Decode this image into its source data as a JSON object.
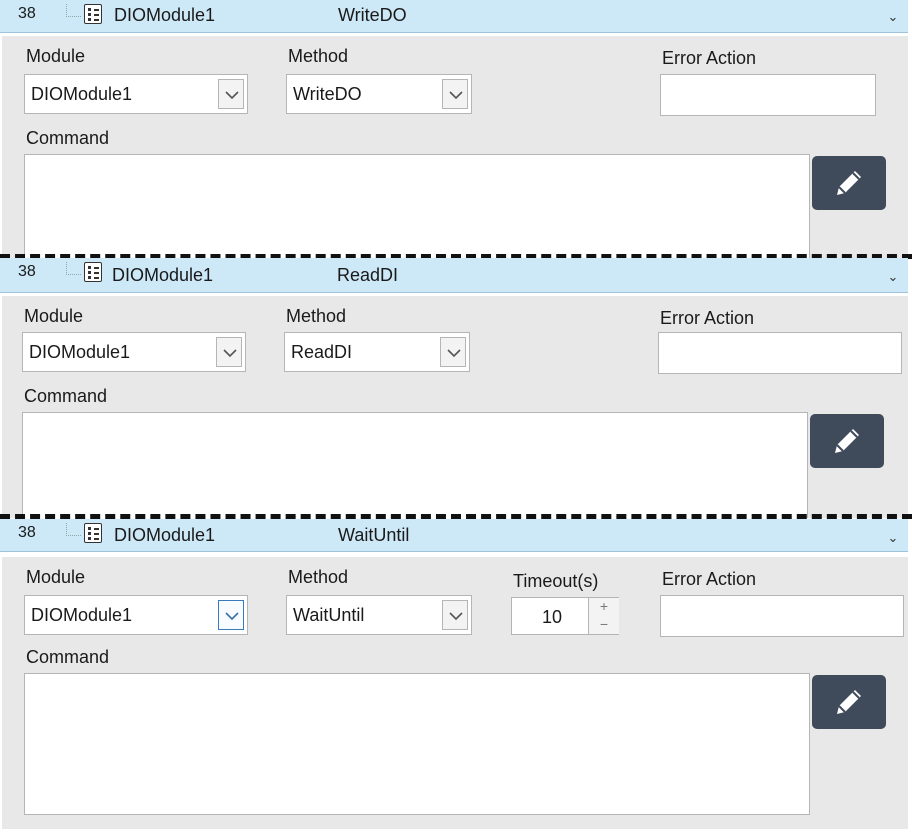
{
  "sections": [
    {
      "step_number": "38",
      "module_name": "DIOModule1",
      "method_name": "WriteDO",
      "labels": {
        "module": "Module",
        "method": "Method",
        "error_action": "Error Action",
        "command": "Command"
      },
      "module_value": "DIOModule1",
      "method_value": "WriteDO",
      "error_action_value": "",
      "command_value": ""
    },
    {
      "step_number": "38",
      "module_name": "DIOModule1",
      "method_name": "ReadDI",
      "labels": {
        "module": "Module",
        "method": "Method",
        "error_action": "Error Action",
        "command": "Command"
      },
      "module_value": "DIOModule1",
      "method_value": "ReadDI",
      "error_action_value": "",
      "command_value": ""
    },
    {
      "step_number": "38",
      "module_name": "DIOModule1",
      "method_name": "WaitUntil",
      "labels": {
        "module": "Module",
        "method": "Method",
        "timeout": "Timeout(s)",
        "error_action": "Error Action",
        "command": "Command"
      },
      "module_value": "DIOModule1",
      "method_value": "WaitUntil",
      "timeout_value": "10",
      "spin_up": "+",
      "spin_down": "−",
      "error_action_value": "",
      "command_value": ""
    }
  ],
  "icons": {
    "collapse": "chevron-down-icon",
    "module": "module-list-icon",
    "edit": "pencil-icon"
  },
  "colors": {
    "header_bg": "#cde8f7",
    "panel_bg": "#e8e8e8",
    "edit_button_bg": "#3f4a5a"
  }
}
